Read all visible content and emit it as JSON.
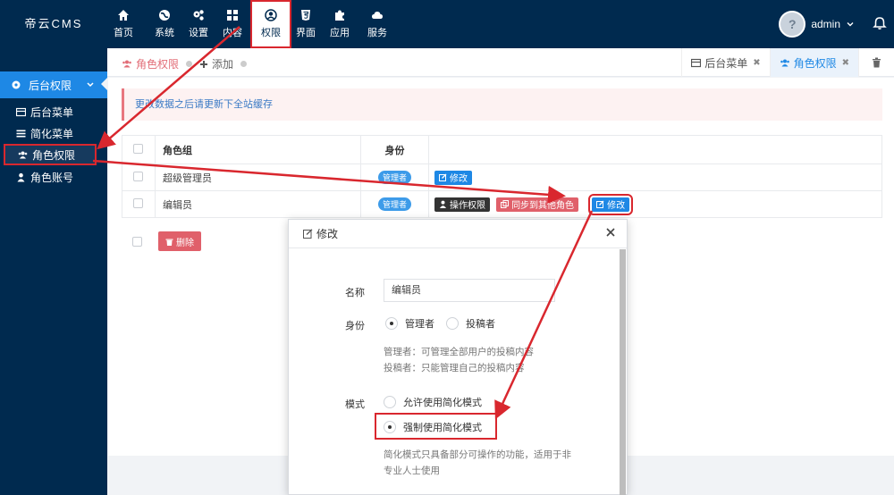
{
  "app": {
    "title": "帝云CMS"
  },
  "topnav": [
    {
      "label": "首页",
      "icon": "home-icon"
    },
    {
      "label": "系统",
      "icon": "globe-icon"
    },
    {
      "label": "设置",
      "icon": "cogs-icon"
    },
    {
      "label": "内容",
      "icon": "grid-icon"
    },
    {
      "label": "权限",
      "icon": "user-circle-icon"
    },
    {
      "label": "界面",
      "icon": "html5-icon"
    },
    {
      "label": "应用",
      "icon": "puzzle-icon"
    },
    {
      "label": "服务",
      "icon": "cloud-icon"
    }
  ],
  "user": {
    "name": "admin"
  },
  "sidebar": {
    "group": "后台权限",
    "items": [
      {
        "label": "后台菜单"
      },
      {
        "label": "简化菜单"
      },
      {
        "label": "角色权限"
      },
      {
        "label": "角色账号"
      }
    ]
  },
  "breadcrumb": {
    "current": "角色权限",
    "next": "添加"
  },
  "tabs": [
    {
      "label": "后台菜单"
    },
    {
      "label": "角色权限"
    }
  ],
  "notice": "更改数据之后请更新下全站缓存",
  "table": {
    "headers": [
      "角色组",
      "身份"
    ],
    "rows": [
      {
        "role": "超级管理员",
        "identity": "管理者",
        "actions": [
          "修改"
        ]
      },
      {
        "role": "编辑员",
        "identity": "管理者",
        "actions": [
          "操作权限",
          "同步到其他角色",
          "修改"
        ]
      }
    ],
    "delete_label": "删除"
  },
  "modal": {
    "title": "修改",
    "name_label": "名称",
    "name_value": "编辑员",
    "identity_label": "身份",
    "identity_options": [
      "管理者",
      "投稿者"
    ],
    "identity_selected": "管理者",
    "identity_help_1": "管理者：可管理全部用户的投稿内容",
    "identity_help_2": "投稿者：只能管理自己的投稿内容",
    "mode_label": "模式",
    "mode_options": [
      "允许使用简化模式",
      "强制使用简化模式"
    ],
    "mode_selected": "强制使用简化模式",
    "mode_help_1": "简化模式只具备部分可操作的功能，适用于非",
    "mode_help_2": "专业人士使用"
  },
  "colors": {
    "navbar": "#002a4f",
    "accent": "#1e88e5",
    "danger": "#e0606a",
    "annotation": "#d9272e"
  }
}
